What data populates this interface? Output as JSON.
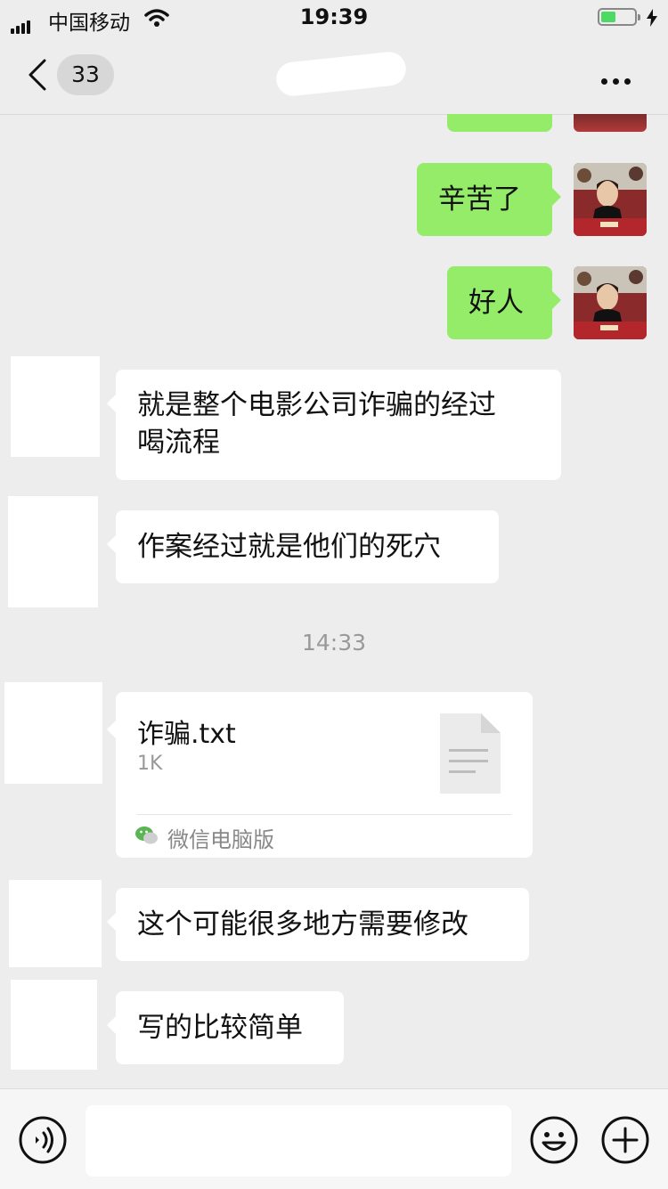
{
  "status_bar": {
    "carrier": "中国移动",
    "time": "19:39",
    "battery_color": "#4cd964"
  },
  "nav": {
    "unread_count": "33"
  },
  "messages": {
    "out_1": "辛苦了",
    "out_2": "好人",
    "in_1_line1": "就是整个电影公司诈骗的经过",
    "in_1_line2": "喝流程",
    "in_2": "作案经过就是他们的死穴",
    "timestamp": "14:33",
    "in_4": "这个可能很多地方需要修改",
    "in_5": "写的比较简单"
  },
  "file": {
    "name": "诈骗.txt",
    "size": "1K",
    "source": "微信电脑版"
  },
  "colors": {
    "outgoing_bubble": "#95ec69",
    "incoming_bubble": "#ffffff",
    "background": "#ededed"
  },
  "icons": [
    "back-chevron-icon",
    "more-dots-icon",
    "signal-icon",
    "wifi-icon",
    "battery-icon",
    "charging-bolt-icon",
    "document-icon",
    "wechat-icon",
    "voice-icon",
    "emoji-icon",
    "plus-icon"
  ]
}
